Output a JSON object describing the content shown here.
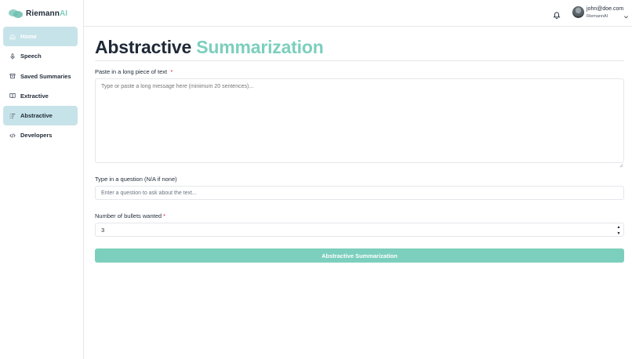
{
  "brand": {
    "name": "Riemann",
    "suffix": "AI"
  },
  "sidebar": {
    "items": [
      {
        "label": "Home",
        "icon": "home-icon",
        "active": true
      },
      {
        "label": "Speech",
        "icon": "microphone-icon",
        "active": false
      },
      {
        "label": "Saved Summaries",
        "icon": "archive-icon",
        "active": false
      },
      {
        "label": "Extractive",
        "icon": "book-icon",
        "active": false
      },
      {
        "label": "Abstractive",
        "icon": "list-icon",
        "active": true
      },
      {
        "label": "Developers",
        "icon": "code-icon",
        "active": false
      }
    ]
  },
  "header": {
    "user_email": "john@doe.com",
    "user_org": "RiemannAI"
  },
  "main": {
    "title_dark": "Abstractive",
    "title_accent": "Summarization",
    "text_label": "Paste in a long piece of text",
    "text_placeholder": "Type or paste a long message here (minimum 20 sentences)...",
    "question_label": "Type in a question (N/A if none)",
    "question_placeholder": "Enter a question to ask about the text...",
    "bullets_label": "Number of bullets wanted",
    "bullets_value": "3",
    "required_marker": "*",
    "submit_label": "Abstractive Summarization"
  },
  "colors": {
    "accent": "#7ccfbd",
    "active_nav": "#c7e3ea",
    "required": "#e11d48"
  }
}
